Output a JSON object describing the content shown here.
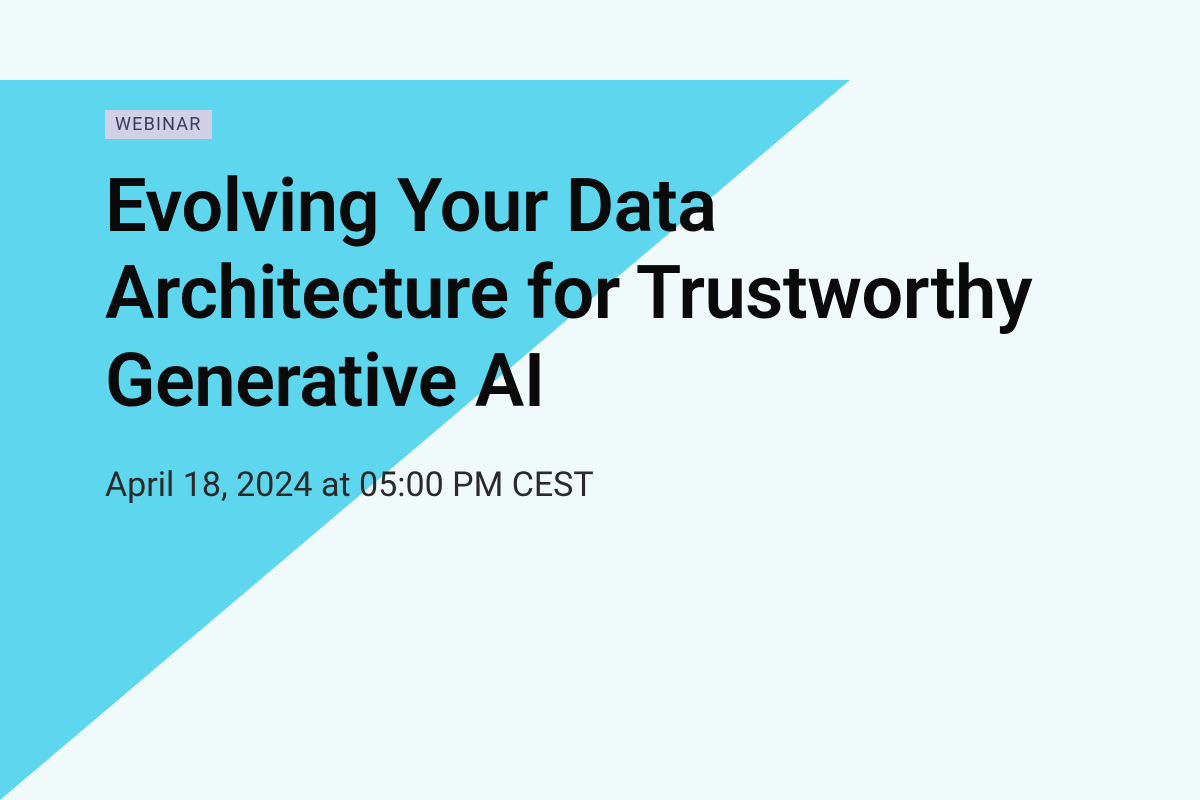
{
  "hero": {
    "tag": "WEBINAR",
    "title": "Evolving Your Data Architecture for Trustworthy Generative AI",
    "datetime": "April 18, 2024 at 05:00 PM CEST"
  }
}
